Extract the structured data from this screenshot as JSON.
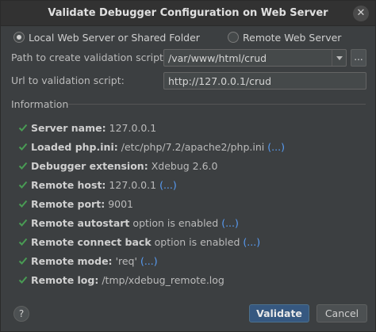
{
  "window": {
    "title": "Validate Debugger Configuration on Web Server"
  },
  "server_type": {
    "option_local": "Local Web Server or Shared Folder",
    "option_remote": "Remote Web Server",
    "selected": "local"
  },
  "form": {
    "path_label": "Path to create validation script:",
    "path_value": "/var/www/html/crud",
    "browse_label": "...",
    "url_label": "Url to validation script:",
    "url_value": "http://127.0.0.1/crud"
  },
  "information": {
    "section_label": "Information",
    "items": [
      {
        "label": "Server name:",
        "value": "127.0.0.1",
        "link": ""
      },
      {
        "label": "Loaded php.ini:",
        "value": "/etc/php/7.2/apache2/php.ini",
        "link": "(...)"
      },
      {
        "label": "Debugger extension:",
        "value": "Xdebug 2.6.0",
        "link": ""
      },
      {
        "label": "Remote host:",
        "value": "127.0.0.1",
        "link": "(...)"
      },
      {
        "label": "Remote port:",
        "value": "9001",
        "link": ""
      },
      {
        "label": "Remote autostart",
        "value": "option is enabled",
        "link": "(...)"
      },
      {
        "label": "Remote connect back",
        "value": "option is enabled",
        "link": "(...)"
      },
      {
        "label": "Remote mode:",
        "value": "'req'",
        "link": "(...)"
      },
      {
        "label": "Remote log:",
        "value": "/tmp/xdebug_remote.log",
        "link": ""
      }
    ]
  },
  "buttons": {
    "help": "?",
    "validate": "Validate",
    "cancel": "Cancel"
  },
  "colors": {
    "check": "#499c54",
    "link": "#589df6",
    "primary_button": "#365880"
  },
  "icons": {
    "check": "check-icon",
    "close": "close-icon",
    "dropdown": "chevron-down-icon",
    "help": "help-icon"
  }
}
